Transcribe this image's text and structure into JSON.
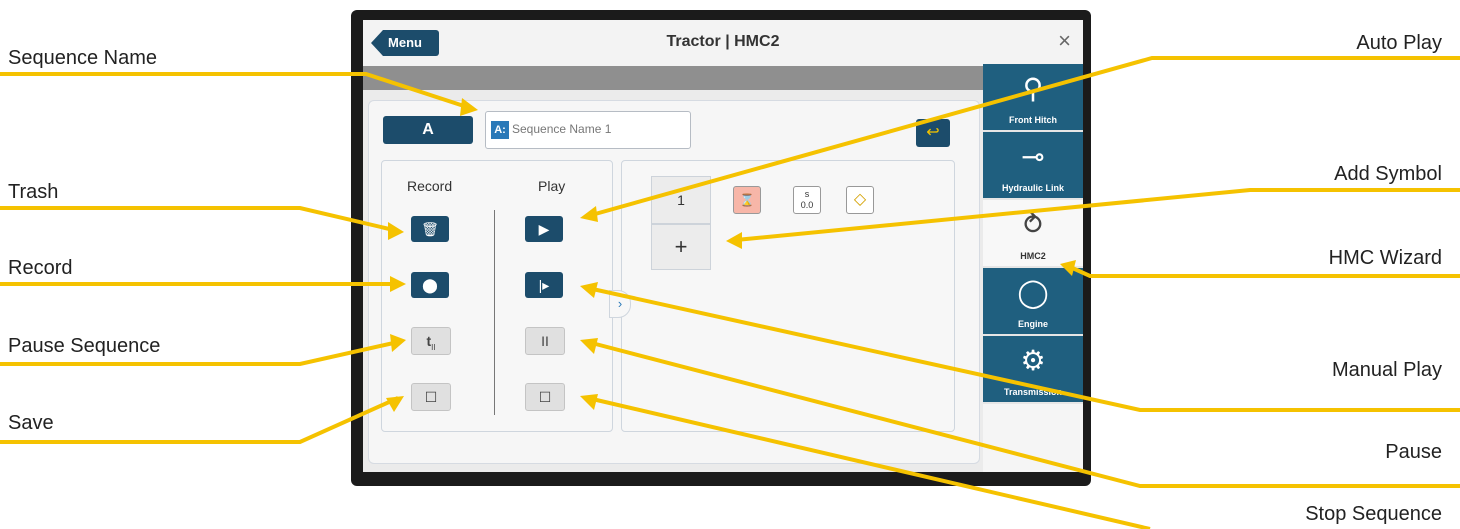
{
  "window": {
    "menu_label": "Menu",
    "title": "Tractor | HMC2",
    "close_glyph": "×"
  },
  "sequence": {
    "slot_label": "A",
    "name_badge": "A:",
    "name_value": "Sequence Name 1"
  },
  "record": {
    "header": "Record",
    "trash_glyph": "🗑",
    "record_glyph": "⬤",
    "pause_glyph": "t",
    "pause_sub": "II",
    "save_glyph": "☐"
  },
  "play": {
    "header": "Play",
    "auto_glyph": "▶",
    "manual_glyph": "|▸",
    "pause_glyph": "II",
    "stop_glyph": "☐"
  },
  "steps": {
    "step_number": "1",
    "add_glyph": "+",
    "symbols": [
      {
        "name": "hourglass",
        "glyph": "⌛"
      },
      {
        "name": "time",
        "glyph_top": "s",
        "glyph_bottom": "0.0"
      },
      {
        "name": "warning",
        "glyph": "◇"
      }
    ]
  },
  "sidebar": {
    "items": [
      {
        "label": "Front Hitch",
        "icon": "front-hitch-icon"
      },
      {
        "label": "Hydraulic Link",
        "icon": "hydraulic-link-icon"
      },
      {
        "label": "HMC2",
        "icon": "hmc-wizard-icon"
      },
      {
        "label": "Engine",
        "icon": "engine-icon"
      },
      {
        "label": "Transmission",
        "icon": "transmission-icon"
      }
    ]
  },
  "annotations": {
    "sequence_name": "Sequence Name",
    "trash": "Trash",
    "record": "Record",
    "pause_sequence": "Pause Sequence",
    "save": "Save",
    "auto_play": "Auto Play",
    "add_symbol": "Add Symbol",
    "hmc_wizard": "HMC Wizard",
    "manual_play": "Manual Play",
    "pause": "Pause",
    "stop_sequence": "Stop Sequence"
  },
  "colors": {
    "accent": "#1c4c6b",
    "callout": "#f5c200",
    "warning": "#d4a100"
  }
}
